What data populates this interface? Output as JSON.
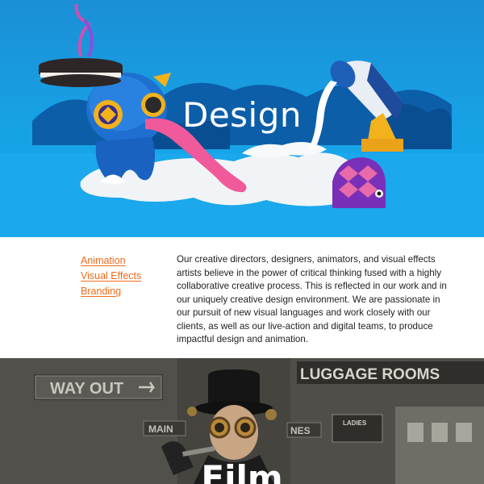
{
  "design_section": {
    "title": "Design",
    "tags": [
      "Animation",
      "Visual Effects",
      "Branding"
    ],
    "description": "Our creative directors, designers, animators, and visual effects artists believe in the power of critical thinking fused with a highly collaborative creative process. This is reflected in our work and in our uniquely creative design environment. We are passionate in our pursuit of new visual languages and work closely with our clients, as well as our live-action and digital teams, to produce impactful design and animation."
  },
  "film_section": {
    "title": "Film",
    "scene_signs": [
      "WAY OUT",
      "LUGGAGE ROOMS",
      "MAIN",
      "NES",
      "LADIES"
    ]
  },
  "colors": {
    "hero_blue": "#18a2e6",
    "link_orange": "#f06a1c",
    "body_text": "#222222"
  }
}
